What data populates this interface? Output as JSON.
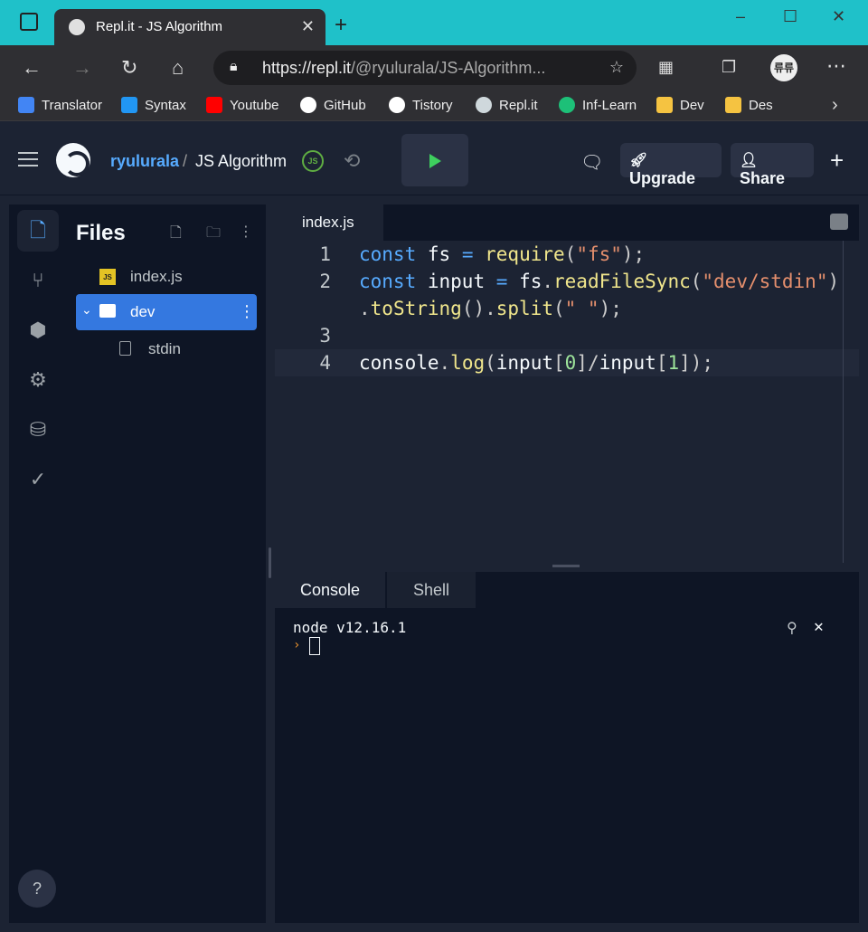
{
  "browser": {
    "tab_title": "Repl.it - JS Algorithm",
    "tab_close": "✕",
    "new_tab": "+",
    "url_host": "https://repl.it",
    "url_path": "/@ryulurala/JS-Algorithm...",
    "profile_initials": "류류"
  },
  "bookmarks": [
    {
      "label": "Translator",
      "color": "#4285f4"
    },
    {
      "label": "Syntax",
      "color": "#2196f3"
    },
    {
      "label": "Youtube",
      "color": "#ff0000"
    },
    {
      "label": "GitHub",
      "color": "#ffffff"
    },
    {
      "label": "Tistory",
      "color": "#ffffff"
    },
    {
      "label": "Repl.it",
      "color": "#cfd8dc"
    },
    {
      "label": "Inf-Learn",
      "color": "#1dc078"
    },
    {
      "label": "Dev",
      "color": "#f5c341"
    },
    {
      "label": "Des",
      "color": "#f5c341"
    }
  ],
  "repl": {
    "owner": "ryulurala",
    "separator": "/",
    "name": "JS Algorithm",
    "language_badge": "JS",
    "upgrade_label": "Upgrade",
    "share_label": "Share",
    "add_label": "+"
  },
  "files_panel": {
    "title": "Files",
    "items": [
      {
        "label": "index.js",
        "type": "file"
      },
      {
        "label": "dev",
        "type": "folder"
      },
      {
        "label": "stdin",
        "type": "file"
      }
    ],
    "js_badge": "JS"
  },
  "editor": {
    "active_tab": "index.js",
    "line_numbers": [
      "1",
      "2",
      "3",
      "4"
    ]
  },
  "console": {
    "tabs": [
      "Console",
      "Shell"
    ],
    "output_line": "node v12.16.1",
    "prompt_symbol": "›"
  },
  "help_label": "?",
  "colors": {
    "accent": "#57abff",
    "run_green": "#3ecf5e",
    "selected_file": "#3478e0",
    "browser_tabbar": "#1fc1c9"
  }
}
